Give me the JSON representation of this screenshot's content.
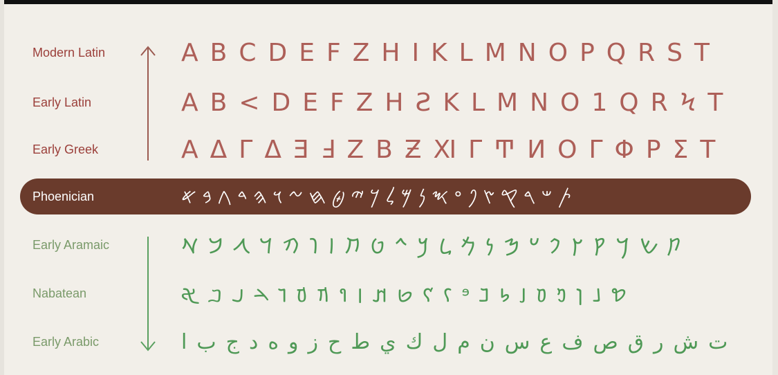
{
  "theme": {
    "accent_red": "#ad5f58",
    "accent_green": "#4f9956",
    "band_color": "#6a3b2c"
  },
  "rows": [
    {
      "label": "Modern Latin",
      "glyphs": [
        "A",
        "B",
        "C",
        "D",
        "E",
        "F",
        "Z",
        "H",
        "I",
        "K",
        "L",
        "M",
        "N",
        "O",
        "P",
        "Q",
        "R",
        "S",
        "T"
      ]
    },
    {
      "label": "Early Latin",
      "glyphs": [
        "A",
        "B",
        "<",
        "D",
        "E",
        "F",
        "Z",
        "H",
        "Ƨ",
        "K",
        "L",
        "M",
        "N",
        "O",
        "1",
        "Q",
        "R",
        "Ϟ",
        "T"
      ]
    },
    {
      "label": "Early Greek",
      "glyphs": [
        "Α",
        "Δ",
        "Γ",
        "Δ",
        "Ǝ",
        "Ⅎ",
        "Ζ",
        "Β",
        "Ƶ",
        "Ⅺ",
        "Γ",
        "Ͳ",
        "Ͷ",
        "Ο",
        "Γ",
        "Φ",
        "Ρ",
        "Σ",
        "Τ"
      ]
    },
    {
      "label": "Phoenician",
      "glyphs": [
        "𐤀",
        "𐤁",
        "𐤂",
        "𐤃",
        "𐤄",
        "𐤅",
        "𐤆",
        "𐤇",
        "𐤈",
        "𐤉",
        "𐤊",
        "𐤋",
        "𐤌",
        "𐤍",
        "𐤎",
        "𐤏",
        "𐤐",
        "𐤑",
        "𐤒",
        "𐤓",
        "𐤔",
        "𐤕"
      ]
    },
    {
      "label": "Early Aramaic",
      "glyphs": [
        "𐡀",
        "𐡁",
        "𐡂",
        "𐡃",
        "𐡄",
        "𐡅",
        "𐡆",
        "𐡇",
        "𐡈",
        "𐡉",
        "𐡊",
        "𐡋",
        "𐡌",
        "𐡍",
        "𐡎",
        "𐡏",
        "𐡐",
        "𐡑",
        "𐡒",
        "𐡓",
        "𐡔",
        "𐡕"
      ]
    },
    {
      "label": "Nabatean",
      "glyphs": [
        "𐢀",
        "𐢂",
        "𐢃",
        "𐢄",
        "𐢅",
        "𐢆",
        "𐢇",
        "𐢈",
        "𐢉",
        "𐢊",
        "𐢋",
        "𐢌",
        "𐢍",
        "𐢎",
        "𐢏",
        "𐢐",
        "𐢑",
        "𐢒",
        "𐢓",
        "𐢔",
        "𐢕",
        "𐢖"
      ]
    },
    {
      "label": "Early Arabic",
      "glyphs": [
        "ا",
        "ب",
        "ج",
        "د",
        "ه",
        "و",
        "ز",
        "ح",
        "ط",
        "ي",
        "ك",
        "ل",
        "م",
        "ن",
        "س",
        "ع",
        "ف",
        "ص",
        "ق",
        "ر",
        "ش",
        "ت"
      ]
    }
  ]
}
